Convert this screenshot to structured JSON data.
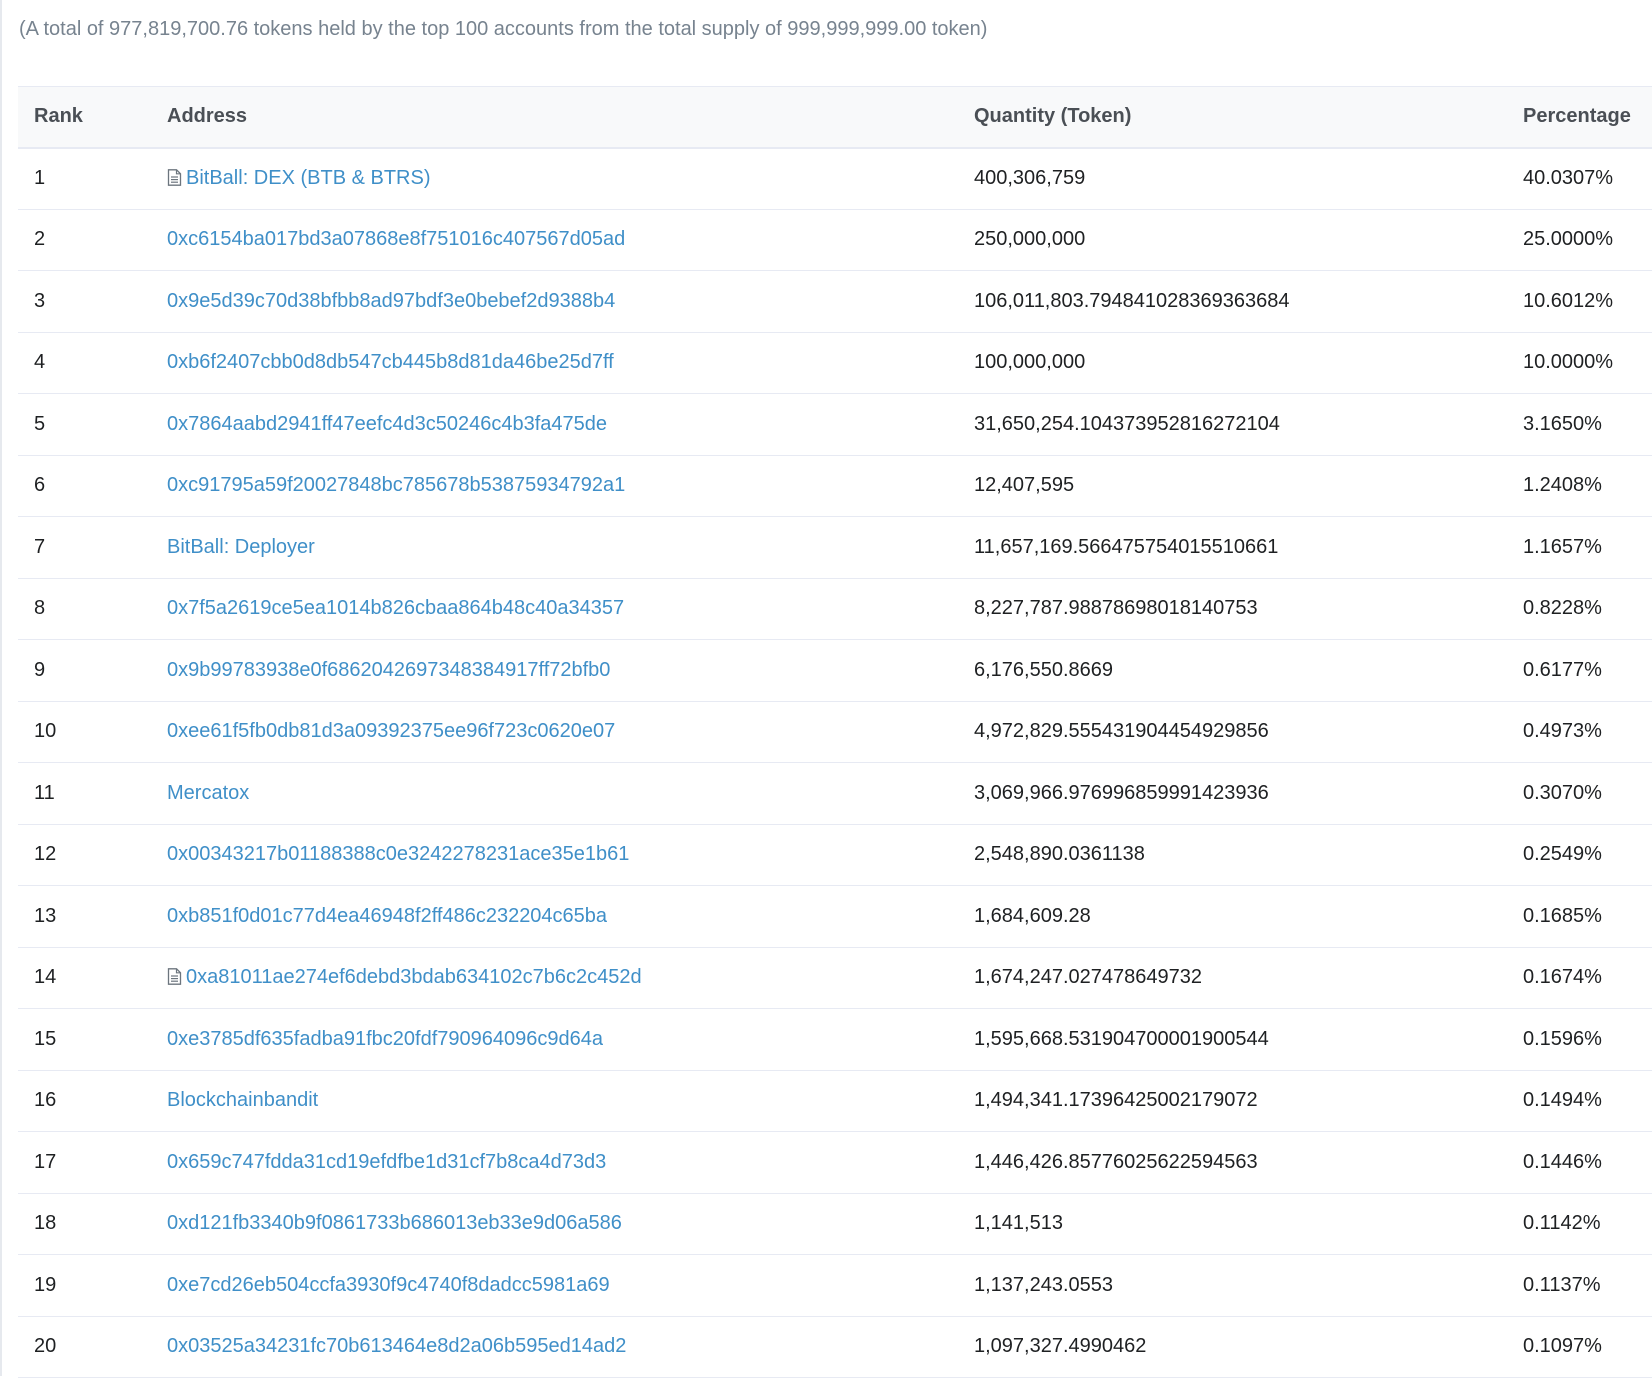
{
  "summary": "(A total of 977,819,700.76 tokens held by the top 100 accounts from the total supply of 999,999,999.00 token)",
  "table": {
    "headers": {
      "rank": "Rank",
      "address": "Address",
      "quantity": "Quantity (Token)",
      "percentage": "Percentage"
    },
    "rows": [
      {
        "rank": "1",
        "address": "BitBall: DEX (BTB & BTRS)",
        "contract": true,
        "quantity": "400,306,759",
        "percentage": "40.0307%"
      },
      {
        "rank": "2",
        "address": "0xc6154ba017bd3a07868e8f751016c407567d05ad",
        "contract": false,
        "quantity": "250,000,000",
        "percentage": "25.0000%"
      },
      {
        "rank": "3",
        "address": "0x9e5d39c70d38bfbb8ad97bdf3e0bebef2d9388b4",
        "contract": false,
        "quantity": "106,011,803.794841028369363684",
        "percentage": "10.6012%"
      },
      {
        "rank": "4",
        "address": "0xb6f2407cbb0d8db547cb445b8d81da46be25d7ff",
        "contract": false,
        "quantity": "100,000,000",
        "percentage": "10.0000%"
      },
      {
        "rank": "5",
        "address": "0x7864aabd2941ff47eefc4d3c50246c4b3fa475de",
        "contract": false,
        "quantity": "31,650,254.104373952816272104",
        "percentage": "3.1650%"
      },
      {
        "rank": "6",
        "address": "0xc91795a59f20027848bc785678b53875934792a1",
        "contract": false,
        "quantity": "12,407,595",
        "percentage": "1.2408%"
      },
      {
        "rank": "7",
        "address": "BitBall: Deployer",
        "contract": false,
        "quantity": "11,657,169.566475754015510661",
        "percentage": "1.1657%"
      },
      {
        "rank": "8",
        "address": "0x7f5a2619ce5ea1014b826cbaa864b48c40a34357",
        "contract": false,
        "quantity": "8,227,787.98878698018140753",
        "percentage": "0.8228%"
      },
      {
        "rank": "9",
        "address": "0x9b99783938e0f6862042697348384917ff72bfb0",
        "contract": false,
        "quantity": "6,176,550.8669",
        "percentage": "0.6177%"
      },
      {
        "rank": "10",
        "address": "0xee61f5fb0db81d3a09392375ee96f723c0620e07",
        "contract": false,
        "quantity": "4,972,829.555431904454929856",
        "percentage": "0.4973%"
      },
      {
        "rank": "11",
        "address": "Mercatox",
        "contract": false,
        "quantity": "3,069,966.976996859991423936",
        "percentage": "0.3070%"
      },
      {
        "rank": "12",
        "address": "0x00343217b01188388c0e3242278231ace35e1b61",
        "contract": false,
        "quantity": "2,548,890.0361138",
        "percentage": "0.2549%"
      },
      {
        "rank": "13",
        "address": "0xb851f0d01c77d4ea46948f2ff486c232204c65ba",
        "contract": false,
        "quantity": "1,684,609.28",
        "percentage": "0.1685%"
      },
      {
        "rank": "14",
        "address": "0xa81011ae274ef6debd3bdab634102c7b6c2c452d",
        "contract": true,
        "quantity": "1,674,247.027478649732",
        "percentage": "0.1674%"
      },
      {
        "rank": "15",
        "address": "0xe3785df635fadba91fbc20fdf790964096c9d64a",
        "contract": false,
        "quantity": "1,595,668.531904700001900544",
        "percentage": "0.1596%"
      },
      {
        "rank": "16",
        "address": "Blockchainbandit",
        "contract": false,
        "quantity": "1,494,341.17396425002179072",
        "percentage": "0.1494%"
      },
      {
        "rank": "17",
        "address": "0x659c747fdda31cd19efdfbe1d31cf7b8ca4d73d3",
        "contract": false,
        "quantity": "1,446,426.85776025622594563",
        "percentage": "0.1446%"
      },
      {
        "rank": "18",
        "address": "0xd121fb3340b9f0861733b686013eb33e9d06a586",
        "contract": false,
        "quantity": "1,141,513",
        "percentage": "0.1142%"
      },
      {
        "rank": "19",
        "address": "0xe7cd26eb504ccfa3930f9c4740f8dadcc5981a69",
        "contract": false,
        "quantity": "1,137,243.0553",
        "percentage": "0.1137%"
      },
      {
        "rank": "20",
        "address": "0x03525a34231fc70b613464e8d2a06b595ed14ad2",
        "contract": false,
        "quantity": "1,097,327.4990462",
        "percentage": "0.1097%"
      }
    ]
  },
  "colors": {
    "link": "#3f8fc8",
    "muted_text": "#77838f",
    "header_bg": "#f8f9fa",
    "border": "#e7eaf3"
  },
  "icons": {
    "contract": "file-document-icon"
  }
}
